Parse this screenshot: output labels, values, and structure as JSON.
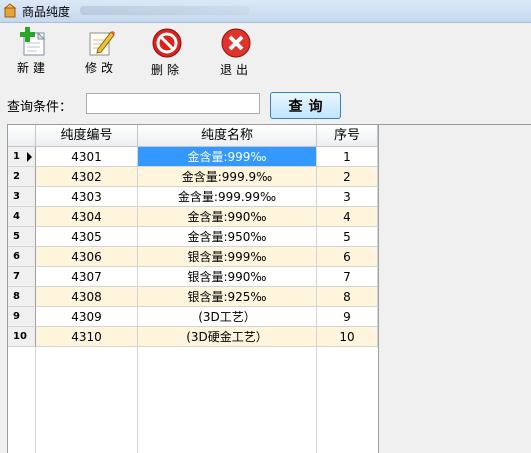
{
  "window": {
    "title": "商品纯度"
  },
  "toolbar": {
    "new_label": "新建",
    "edit_label": "修改",
    "delete_label": "删除",
    "exit_label": "退出"
  },
  "search": {
    "label": "查询条件：",
    "value": "",
    "button_label": "查询"
  },
  "grid": {
    "columns": [
      "纯度编号",
      "纯度名称",
      "序号"
    ],
    "selected_row": 1,
    "rows": [
      {
        "num": "1",
        "code": "4301",
        "name": "金含量:999‰",
        "seq": "1"
      },
      {
        "num": "2",
        "code": "4302",
        "name": "金含量:999.9‰",
        "seq": "2"
      },
      {
        "num": "3",
        "code": "4303",
        "name": "金含量:999.99‰",
        "seq": "3"
      },
      {
        "num": "4",
        "code": "4304",
        "name": "金含量:990‰",
        "seq": "4"
      },
      {
        "num": "5",
        "code": "4305",
        "name": "金含量:950‰",
        "seq": "5"
      },
      {
        "num": "6",
        "code": "4306",
        "name": "银含量:999‰",
        "seq": "6"
      },
      {
        "num": "7",
        "code": "4307",
        "name": "银含量:990‰",
        "seq": "7"
      },
      {
        "num": "8",
        "code": "4308",
        "name": "银含量:925‰",
        "seq": "8"
      },
      {
        "num": "9",
        "code": "4309",
        "name": "(3D工艺）",
        "seq": "9"
      },
      {
        "num": "10",
        "code": "4310",
        "name": "(3D硬金工艺）",
        "seq": "10"
      }
    ]
  },
  "icons": {
    "new": "add-document-icon",
    "edit": "edit-pencil-icon",
    "delete": "delete-no-icon",
    "exit": "close-x-icon"
  },
  "colors": {
    "selection": "#3399ff",
    "alt_row": "#fff5dc",
    "delete_red": "#d9231c"
  }
}
